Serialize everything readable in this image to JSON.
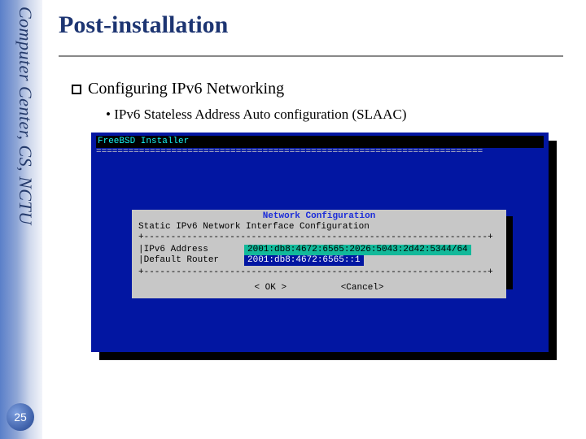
{
  "sidebar": {
    "org_text": "Computer Center, CS, NCTU",
    "page_number": "25"
  },
  "slide": {
    "title": "Post-installation",
    "section": "Configuring IPv6 Networking",
    "sub_bullet": "IPv6 Stateless Address Auto configuration (SLAAC)"
  },
  "terminal": {
    "installer_label": "FreeBSD Installer",
    "dashline": "========================================================================",
    "dialog": {
      "title": "Network Configuration",
      "subtitle": "Static IPv6 Network Interface Configuration",
      "border_row": "+----------------------------------------------------------------+",
      "fields": [
        {
          "label": "|IPv6 Address   ",
          "value": "2001:db8:4672:6565:2026:5043:2d42:5344/64",
          "active": true
        },
        {
          "label": "|Default Router ",
          "value": "2001:db8:4672:6565::1                    ",
          "active": false
        }
      ],
      "ok_label": "<  OK  >",
      "cancel_label": "<Cancel>"
    }
  }
}
